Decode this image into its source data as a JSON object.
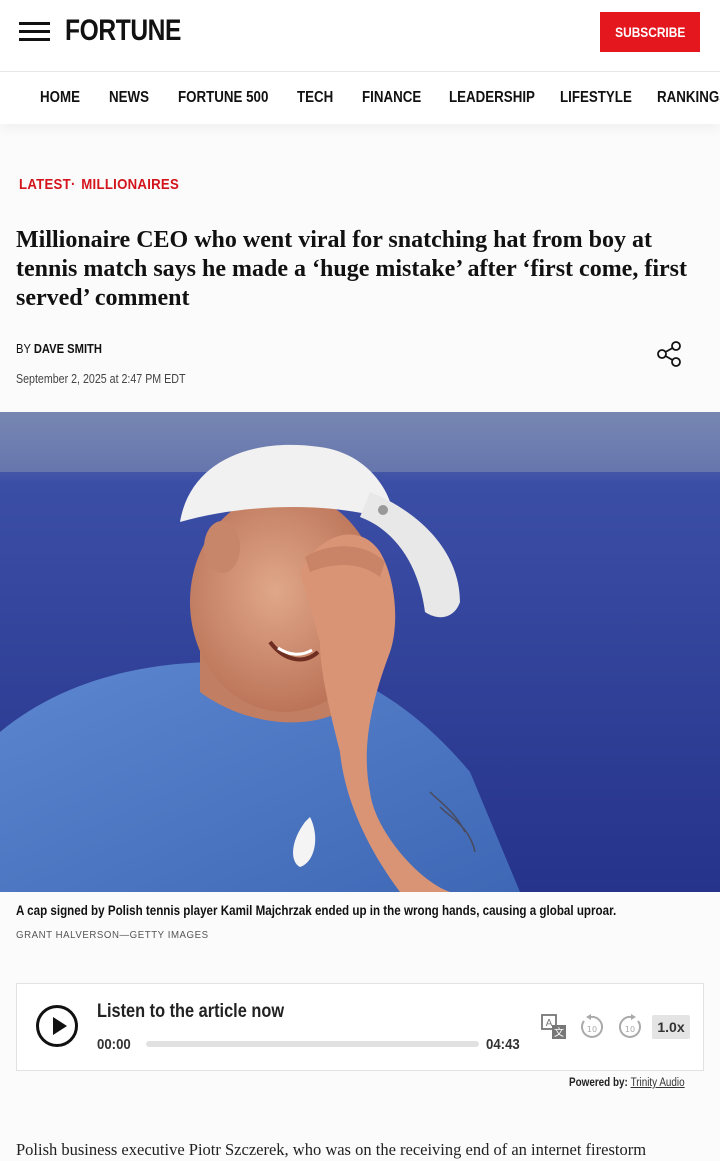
{
  "header": {
    "logo": "FORTUNE",
    "subscribe_label": "SUBSCRIBE",
    "menu_icon": "hamburger-menu-icon"
  },
  "nav": {
    "items": [
      "HOME",
      "NEWS",
      "FORTUNE 500",
      "TECH",
      "FINANCE",
      "LEADERSHIP",
      "LIFESTYLE",
      "RANKINGS"
    ]
  },
  "article": {
    "category_latest": "LATEST",
    "category_separator": "·",
    "category_section": "MILLIONAIRES",
    "headline": "Millionaire CEO who went viral for snatching hat from boy at tennis match says he made a ‘huge mistake’ after ‘first come, first served’ comment",
    "byline_prefix": "BY",
    "author": "DAVE SMITH",
    "date": "September 2, 2025 at 2:47 PM EDT",
    "share_icon": "share-icon",
    "image_caption": "A cap signed by Polish tennis player Kamil Majchrzak ended up in the wrong hands, causing a global uproar.",
    "image_credit": "GRANT HALVERSON—GETTY IMAGES",
    "body_first_line": "Polish business executive Piotr Szczerek, who was on the receiving end of an internet firestorm"
  },
  "audio_player": {
    "title": "Listen to the article now",
    "current_time": "00:00",
    "total_time": "04:43",
    "progress": 0,
    "speed": "1.0x",
    "powered_by_label": "Powered by:",
    "powered_by_link": "Trinity Audio",
    "icons": [
      "play-icon",
      "translate-icon",
      "rewind-10-icon",
      "forward-10-icon"
    ]
  },
  "colors": {
    "brand_red": "#e4161e",
    "category_red": "#d3141b",
    "hero_blue": "#2c3c8c"
  }
}
